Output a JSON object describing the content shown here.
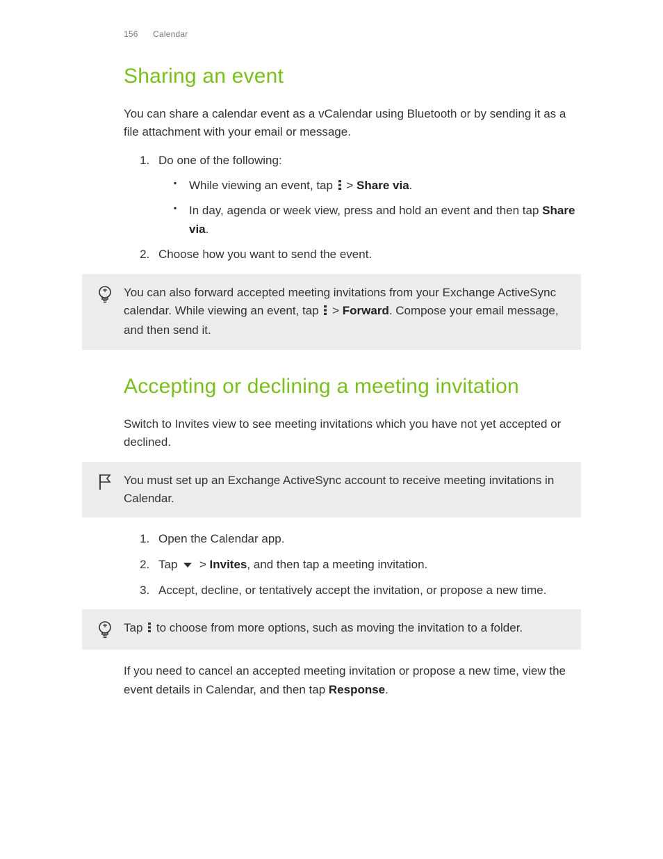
{
  "header": {
    "page_number": "156",
    "section": "Calendar"
  },
  "section1": {
    "title": "Sharing an event",
    "intro": "You can share a calendar event as a vCalendar using Bluetooth or by sending it as a file attachment with your email or message.",
    "step1_lead": "Do one of the following:",
    "bullet1_a": "While viewing an event, tap ",
    "bullet1_b": " > ",
    "bullet1_bold": "Share via",
    "bullet1_c": ".",
    "bullet2_a": "In day, agenda or week view, press and hold an event and then tap ",
    "bullet2_bold": "Share via",
    "bullet2_c": ".",
    "step2": "Choose how you want to send the event.",
    "tip_a": "You can also forward accepted meeting invitations from your Exchange ActiveSync calendar. While viewing an event, tap ",
    "tip_b": " > ",
    "tip_bold": "Forward",
    "tip_c": ". Compose your email message, and then send it."
  },
  "section2": {
    "title": "Accepting or declining a meeting invitation",
    "intro": "Switch to Invites view to see meeting invitations which you have not yet accepted or declined.",
    "note": "You must set up an Exchange ActiveSync account to receive meeting invitations in Calendar.",
    "step1": "Open the Calendar app.",
    "step2_a": "Tap ",
    "step2_b": " > ",
    "step2_bold": "Invites",
    "step2_c": ", and then tap a meeting invitation.",
    "step3": "Accept, decline, or tentatively accept the invitation, or propose a new time.",
    "tip_a": "Tap ",
    "tip_b": " to choose from more options, such as moving the invitation to a folder.",
    "closing_a": "If you need to cancel an accepted meeting invitation or propose a new time, view the event details in Calendar, and then tap ",
    "closing_bold": "Response",
    "closing_b": "."
  }
}
